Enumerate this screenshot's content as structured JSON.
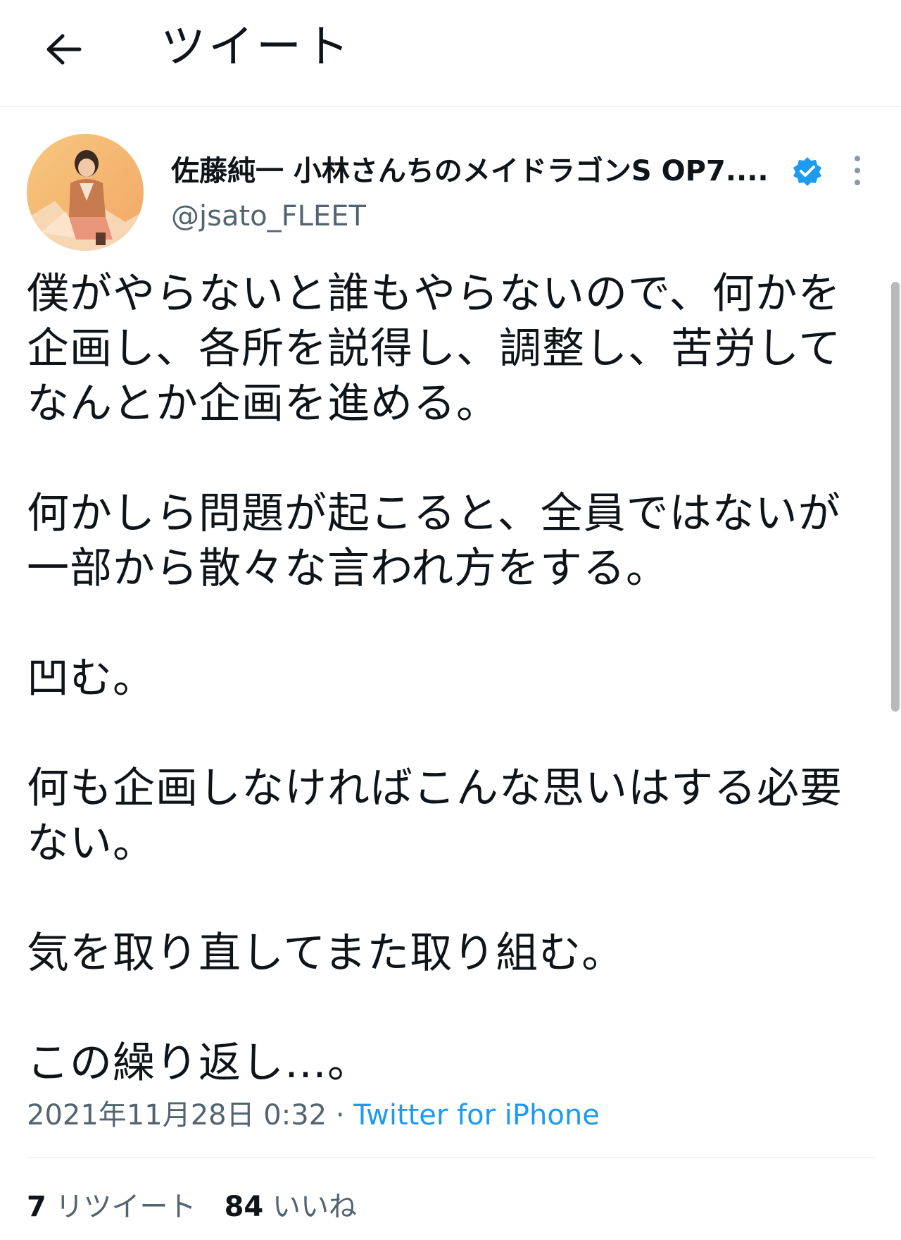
{
  "header": {
    "title": "ツイート",
    "back_icon": "arrow-left-icon"
  },
  "author": {
    "display_name": "佐藤純一 小林さんちのメイドラゴンS OP7....",
    "handle": "@jsato_FLEET",
    "verified": true,
    "verified_color": "#1d9bf0"
  },
  "tweet": {
    "paragraphs": [
      [
        "僕がやらないと誰もやらないので、何かを",
        "企画し、各所を説得し、調整し、苦労して",
        "なんとか企画を進める。"
      ],
      [
        "何かしら問題が起こると、全員ではないが",
        "一部から散々な言われ方をする。"
      ],
      [
        "凹む。"
      ],
      [
        "何も企画しなければこんな思いはする必要",
        "ない。"
      ],
      [
        "気を取り直してまた取り組む。"
      ],
      [
        "この繰り返し…。"
      ]
    ]
  },
  "meta": {
    "timestamp": "2021年11月28日 0:32",
    "separator": " · ",
    "source": "Twitter for iPhone",
    "source_color": "#1d9bf0"
  },
  "stats": {
    "retweets_count": "7",
    "retweets_label": "リツイート",
    "likes_count": "84",
    "likes_label": "いいね"
  }
}
